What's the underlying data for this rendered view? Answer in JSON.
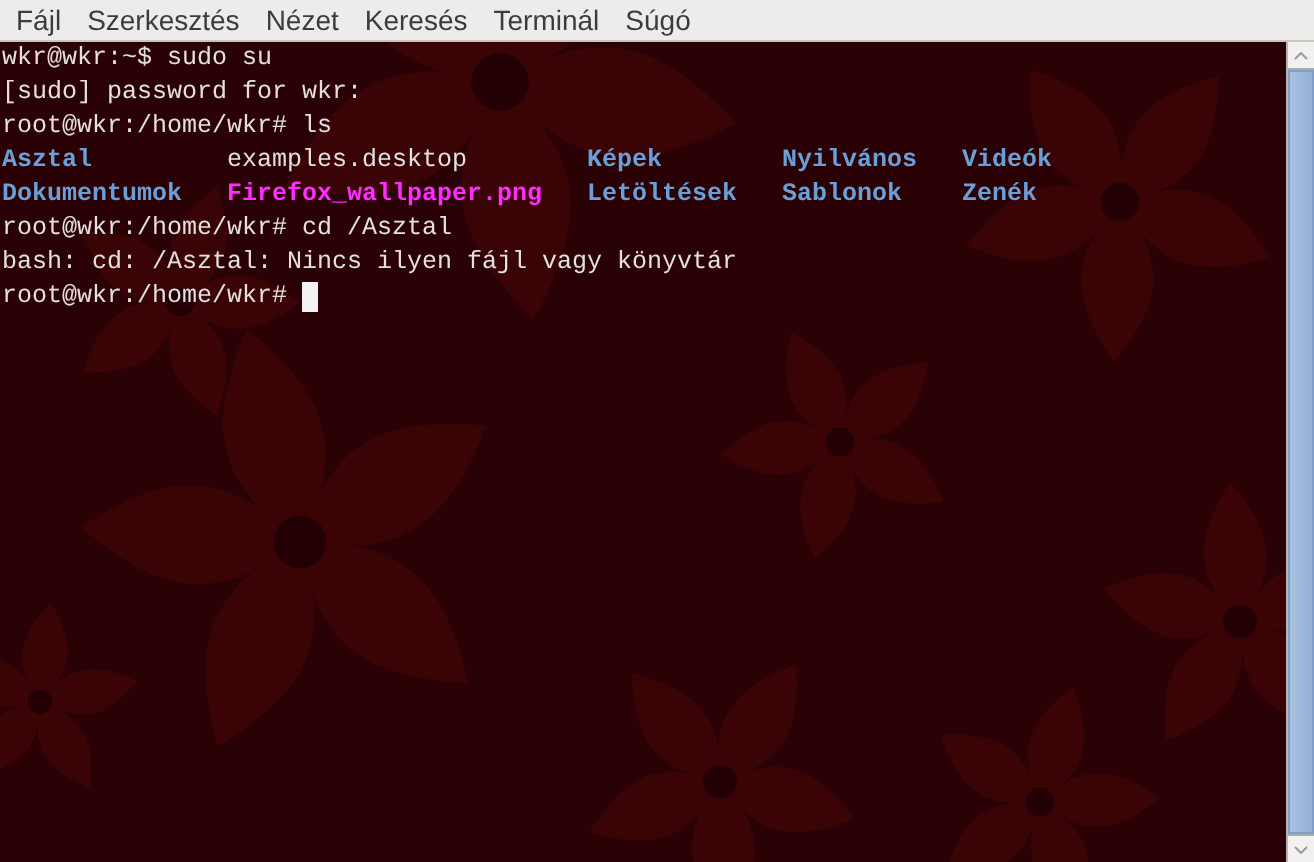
{
  "menu": [
    {
      "label": "Fájl"
    },
    {
      "label": "Szerkesztés"
    },
    {
      "label": "Nézet"
    },
    {
      "label": "Keresés"
    },
    {
      "label": "Terminál"
    },
    {
      "label": "Súgó"
    }
  ],
  "terminal": {
    "lines": [
      {
        "kind": "text",
        "text": "wkr@wkr:~$ sudo su"
      },
      {
        "kind": "text",
        "text": "[sudo] password for wkr:"
      },
      {
        "kind": "text",
        "text": "root@wkr:/home/wkr# ls"
      },
      {
        "kind": "ls",
        "cells": [
          {
            "kind": "dir",
            "text": "Asztal"
          },
          {
            "kind": "file",
            "text": "examples.desktop"
          },
          {
            "kind": "dir",
            "text": "Képek"
          },
          {
            "kind": "dir",
            "text": "Nyilvános"
          },
          {
            "kind": "dir",
            "text": "Videók"
          }
        ]
      },
      {
        "kind": "ls",
        "cells": [
          {
            "kind": "dir",
            "text": "Dokumentumok"
          },
          {
            "kind": "image",
            "text": "Firefox_wallpaper.png"
          },
          {
            "kind": "dir",
            "text": "Letöltések"
          },
          {
            "kind": "dir",
            "text": "Sablonok"
          },
          {
            "kind": "dir",
            "text": "Zenék"
          }
        ]
      },
      {
        "kind": "text",
        "text": "root@wkr:/home/wkr# cd /Asztal"
      },
      {
        "kind": "text",
        "text": "bash: cd: /Asztal: Nincs ilyen fájl vagy könyvtár"
      },
      {
        "kind": "text",
        "text": "root@wkr:/home/wkr#",
        "cursor": true
      }
    ]
  }
}
